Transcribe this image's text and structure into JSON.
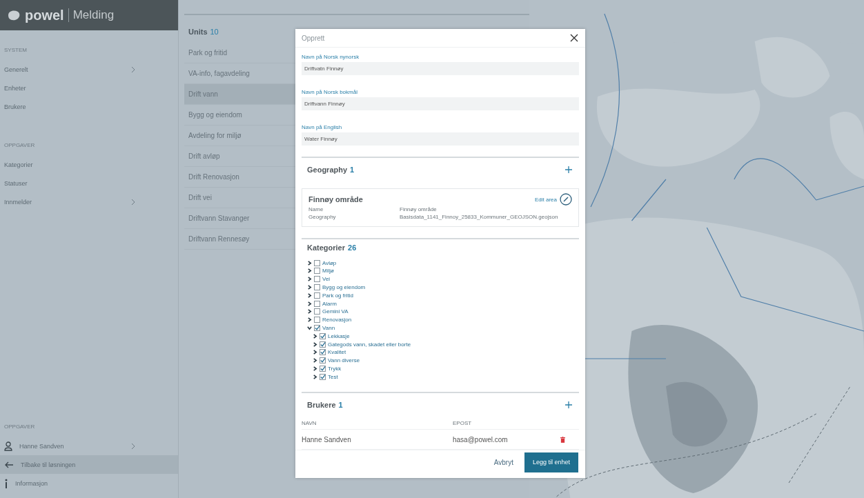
{
  "app": {
    "brand": "powel",
    "product": "Melding"
  },
  "sidebar": {
    "sections": [
      {
        "heading": "SYSTEM",
        "items": [
          {
            "label": "Generelt",
            "submenu": true
          },
          {
            "label": "Enheter",
            "submenu": false
          },
          {
            "label": "Brukere",
            "submenu": false
          }
        ]
      },
      {
        "heading": "OPPGAVER",
        "items": [
          {
            "label": "Kategorier",
            "submenu": false
          },
          {
            "label": "Statuser",
            "submenu": false
          },
          {
            "label": "Innmelder",
            "submenu": true
          }
        ]
      }
    ],
    "footer": {
      "heading": "OPPGAVER",
      "items": [
        {
          "kind": "user",
          "label": "Hanne Sandven",
          "submenu": true,
          "selected": false
        },
        {
          "kind": "back",
          "label": "Tilbake til løsningen",
          "submenu": false,
          "selected": true
        },
        {
          "kind": "info",
          "label": "Informasjon",
          "submenu": false,
          "selected": false
        }
      ]
    }
  },
  "units": {
    "title": "Units",
    "count": "10",
    "items": [
      {
        "label": "Park og fritid",
        "selected": false
      },
      {
        "label": "VA-info, fagavdeling",
        "selected": false
      },
      {
        "label": "Drift vann",
        "selected": true
      },
      {
        "label": "Bygg og eiendom",
        "selected": false
      },
      {
        "label": "Avdeling for miljø",
        "selected": false
      },
      {
        "label": "Drift avløp",
        "selected": false
      },
      {
        "label": "Drift Renovasjon",
        "selected": false
      },
      {
        "label": "Drift vei",
        "selected": false
      },
      {
        "label": "Driftvann Stavanger",
        "selected": false
      },
      {
        "label": "Driftvann Rennesøy",
        "selected": false
      }
    ]
  },
  "dialog": {
    "title": "Opprett",
    "fields": [
      {
        "label": "Navn på Norsk nynorsk",
        "value": "Driftvatn Finnøy"
      },
      {
        "label": "Navn på Norsk bokmål",
        "value": "Driftvann Finnøy"
      },
      {
        "label": "Navn på English",
        "value": "Water Finnøy"
      }
    ],
    "geography": {
      "title": "Geography",
      "count": "1",
      "card": {
        "title": "Finnøy område",
        "edit": "Edit area",
        "rows": [
          {
            "key": "Name",
            "value": "Finnøy område"
          },
          {
            "key": "Geography",
            "value": "Basisdata_1141_Finnoy_25833_Kommuner_GEOJSON.geojson"
          }
        ]
      }
    },
    "categories": {
      "title": "Kategorier",
      "count": "26",
      "items": [
        {
          "label": "Avløp",
          "checked": false,
          "expanded": false
        },
        {
          "label": "Miljø",
          "checked": false,
          "expanded": false
        },
        {
          "label": "Vei",
          "checked": false,
          "expanded": false
        },
        {
          "label": "Bygg og eiendom",
          "checked": false,
          "expanded": false
        },
        {
          "label": "Park og fritid",
          "checked": false,
          "expanded": false
        },
        {
          "label": "Alarm",
          "checked": false,
          "expanded": false
        },
        {
          "label": "Gemini VA",
          "checked": false,
          "expanded": false
        },
        {
          "label": "Renovasjon",
          "checked": false,
          "expanded": false
        },
        {
          "label": "Vann",
          "checked": true,
          "expanded": true,
          "children": [
            {
              "label": "Lekkasje",
              "checked": true,
              "expanded": false
            },
            {
              "label": "Gategods vann, skadet eller borte",
              "checked": true,
              "expanded": false
            },
            {
              "label": "Kvalitet",
              "checked": true,
              "expanded": false
            },
            {
              "label": "Vann diverse",
              "checked": true,
              "expanded": false
            },
            {
              "label": "Trykk",
              "checked": true,
              "expanded": false
            },
            {
              "label": "Test",
              "checked": true,
              "expanded": false
            }
          ]
        }
      ]
    },
    "users": {
      "title": "Brukere",
      "count": "1",
      "columns": [
        "NAVN",
        "EPOST"
      ],
      "rows": [
        {
          "name": "Hanne Sandven",
          "email": "hasa@powel.com"
        }
      ]
    },
    "buttons": {
      "cancel": "Avbryt",
      "submit": "Legg til enhet"
    }
  }
}
